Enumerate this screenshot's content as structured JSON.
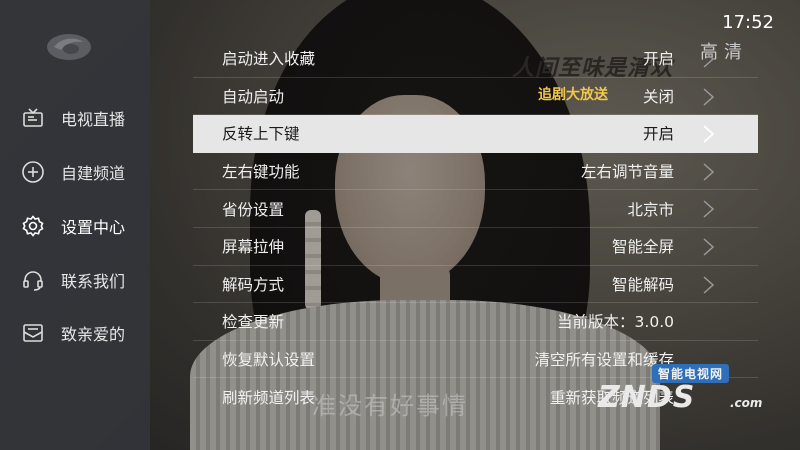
{
  "status": {
    "time": "17:52",
    "quality": "高清"
  },
  "overlay": {
    "show_title": "人间至味是清欢",
    "show_subtitle": "追剧大放送",
    "subtitle_text": "准没有好事情"
  },
  "sidebar": {
    "items": [
      {
        "label": "电视直播",
        "icon": "tv-icon"
      },
      {
        "label": "自建频道",
        "icon": "plus-circle-icon"
      },
      {
        "label": "设置中心",
        "icon": "gear-icon",
        "active": true
      },
      {
        "label": "联系我们",
        "icon": "headset-icon"
      },
      {
        "label": "致亲爱的",
        "icon": "mail-icon"
      }
    ]
  },
  "settings": {
    "rows": [
      {
        "name": "启动进入收藏",
        "value": "开启"
      },
      {
        "name": "自动启动",
        "value": "关闭"
      },
      {
        "name": "反转上下键",
        "value": "开启",
        "selected": true
      },
      {
        "name": "左右键功能",
        "value": "左右调节音量"
      },
      {
        "name": "省份设置",
        "value": "北京市"
      },
      {
        "name": "屏幕拉伸",
        "value": "智能全屏"
      },
      {
        "name": "解码方式",
        "value": "智能解码"
      },
      {
        "name": "检查更新",
        "value": "当前版本：3.0.0"
      },
      {
        "name": "恢复默认设置",
        "value": "清空所有设置和缓存"
      },
      {
        "name": "刷新频道列表",
        "value": "重新获取频道列表"
      }
    ]
  },
  "watermark": {
    "top": "智能电视网",
    "main": "ZNDS",
    "domain": ".com"
  },
  "colors": {
    "selected_row": "#e6e6e6",
    "sidebar_bg": "#32343a",
    "accent_yellow": "#f2c84b"
  }
}
